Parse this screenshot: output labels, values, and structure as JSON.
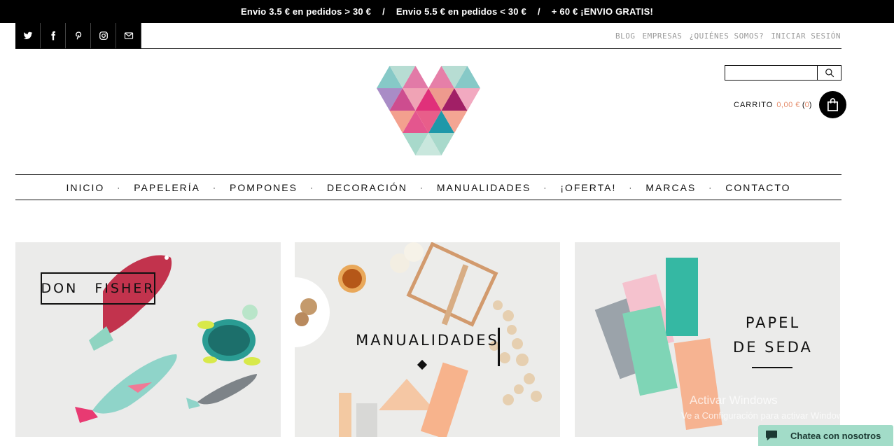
{
  "announcement": {
    "part1": "Envio 3.5 € en pedidos > 30 €",
    "sep": "/",
    "part2": "Envio 5.5 € en pedidos < 30 €",
    "part3": "+ 60 € ¡ENVIO GRATIS!"
  },
  "social": [
    "twitter-icon",
    "facebook-icon",
    "pinterest-icon",
    "instagram-icon",
    "email-icon"
  ],
  "toplinks": [
    "BLOG",
    "EMPRESAS",
    "¿QUIÉNES SOMOS?",
    "INICIAR SESIÓN"
  ],
  "search": {
    "placeholder": ""
  },
  "cart": {
    "label": "CARRITO",
    "price": "0,00 €",
    "count_open": "(",
    "count": "0",
    "count_close": ")"
  },
  "nav": [
    "INICIO",
    "PAPELERÍA",
    "POMPONES",
    "DECORACIÓN",
    "MANUALIDADES",
    "¡OFERTA!",
    "MARCAS",
    "CONTACTO"
  ],
  "nav_sep": "·",
  "tiles": {
    "t1": {
      "brand_left": "DON",
      "brand_right": "FISHER"
    },
    "t2": {
      "label": "MANUALIDADES"
    },
    "t3": {
      "line1": "PAPEL",
      "line2": "DE SEDA"
    }
  },
  "watermark": {
    "line1": "Activar Windows",
    "line2": "Ve a Configuración para activar Windows."
  },
  "chat": {
    "label": "Chatea con nosotros"
  },
  "colors": {
    "accent": "#e58c6b",
    "chat_bg": "#a2dcc8"
  }
}
